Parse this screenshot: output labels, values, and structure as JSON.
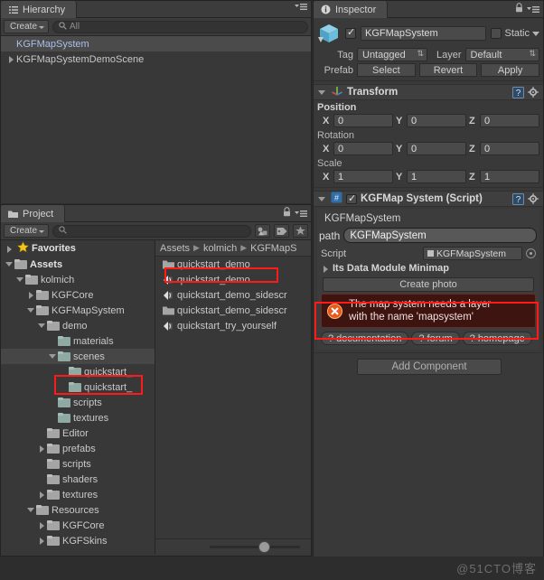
{
  "hierarchy": {
    "tab_label": "Hierarchy",
    "tab_icon": "hierarchy-icon",
    "create_label": "Create",
    "search_placeholder": "All",
    "search_value": "All",
    "items": [
      {
        "label": "KGFMapSystem",
        "selected": true,
        "expandable": false
      },
      {
        "label": "KGFMapSystemDemoScene",
        "selected": false,
        "expandable": true
      }
    ]
  },
  "project": {
    "tab_label": "Project",
    "create_label": "Create",
    "search_value": "",
    "filter_icons": [
      "type-filter-icon",
      "label-filter-icon",
      "favorite-filter-icon"
    ],
    "favorites_label": "Favorites",
    "breadcrumb": [
      "Assets",
      "kolmich",
      "KGFMapS"
    ],
    "tree": [
      {
        "label": "Assets",
        "indent": 0,
        "state": "open",
        "bold": true,
        "selected": false
      },
      {
        "label": "kolmich",
        "indent": 1,
        "state": "open",
        "bold": false,
        "selected": false
      },
      {
        "label": "KGFCore",
        "indent": 2,
        "state": "closed",
        "bold": false,
        "selected": false
      },
      {
        "label": "KGFMapSystem",
        "indent": 2,
        "state": "open",
        "bold": false,
        "selected": false
      },
      {
        "label": "demo",
        "indent": 3,
        "state": "open",
        "bold": false,
        "selected": false
      },
      {
        "label": "materials",
        "indent": 4,
        "state": "leaf",
        "bold": false,
        "selected": false
      },
      {
        "label": "scenes",
        "indent": 4,
        "state": "open",
        "bold": false,
        "selected": true
      },
      {
        "label": "quickstart_",
        "indent": 5,
        "state": "leaf",
        "bold": false,
        "selected": false
      },
      {
        "label": "quickstart_",
        "indent": 5,
        "state": "leaf",
        "bold": false,
        "selected": false
      },
      {
        "label": "scripts",
        "indent": 4,
        "state": "leaf",
        "bold": false,
        "selected": false
      },
      {
        "label": "textures",
        "indent": 4,
        "state": "leaf",
        "bold": false,
        "selected": false
      },
      {
        "label": "Editor",
        "indent": 3,
        "state": "leaf",
        "bold": false,
        "selected": false
      },
      {
        "label": "prefabs",
        "indent": 3,
        "state": "closed",
        "bold": false,
        "selected": false
      },
      {
        "label": "scripts",
        "indent": 3,
        "state": "leaf",
        "bold": false,
        "selected": false
      },
      {
        "label": "shaders",
        "indent": 3,
        "state": "leaf",
        "bold": false,
        "selected": false
      },
      {
        "label": "textures",
        "indent": 3,
        "state": "closed",
        "bold": false,
        "selected": false
      },
      {
        "label": "Resources",
        "indent": 2,
        "state": "open",
        "bold": false,
        "selected": false
      },
      {
        "label": "KGFCore",
        "indent": 3,
        "state": "closed",
        "bold": false,
        "selected": false
      },
      {
        "label": "KGFSkins",
        "indent": 3,
        "state": "closed",
        "bold": false,
        "selected": false
      }
    ],
    "assets": [
      {
        "label": "quickstart_demo",
        "icon": "folder-icon",
        "selected": false
      },
      {
        "label": "quickstart_demo",
        "icon": "unity-scene-icon",
        "selected": true
      },
      {
        "label": "quickstart_demo_sidescr",
        "icon": "unity-scene-icon",
        "selected": false
      },
      {
        "label": "quickstart_demo_sidescr",
        "icon": "folder-icon",
        "selected": false
      },
      {
        "label": "quickstart_try_yourself",
        "icon": "unity-scene-icon",
        "selected": false
      }
    ],
    "zoom_slider_value": 62
  },
  "inspector": {
    "tab_label": "Inspector",
    "tab_icon": "info-icon",
    "lock_icon": "lock-icon",
    "menu_icon": "hamburger-icon",
    "object_enabled": true,
    "object_name": "KGFMapSystem",
    "static_label": "Static",
    "static_checked": false,
    "tag_label": "Tag",
    "tag_value": "Untagged",
    "layer_label": "Layer",
    "layer_value": "Default",
    "prefab_label": "Prefab",
    "prefab_buttons": [
      "Select",
      "Revert",
      "Apply"
    ],
    "transform": {
      "title": "Transform",
      "icon": "transform-axis-icon",
      "help_icon": "help-book-icon",
      "gear_icon": "gear-icon",
      "position_label": "Position",
      "rotation_label": "Rotation",
      "scale_label": "Scale",
      "position": {
        "x": "0",
        "y": "0",
        "z": "0"
      },
      "rotation": {
        "x": "0",
        "y": "0",
        "z": "0"
      },
      "scale": {
        "x": "1",
        "y": "1",
        "z": "1"
      },
      "axis_labels": [
        "X",
        "Y",
        "Z"
      ]
    },
    "script_component": {
      "title": "KGFMap System (Script)",
      "icon": "cs-script-icon",
      "enabled": true,
      "help_icon": "help-book-icon",
      "gear_icon": "gear-icon",
      "inner_title": "KGFMapSystem",
      "path_label": "path",
      "path_value": "KGFMapSystem",
      "script_label": "Script",
      "script_value": "KGFMapSystem",
      "script_picker_icon": "object-picker-icon",
      "data_module_label": "Its Data Module Minimap",
      "create_photo_label": "Create photo",
      "error": {
        "icon": "error-x-icon",
        "line1": "The map system needs a layer",
        "line2": "with the name 'mapsystem'"
      },
      "links": [
        "? documentation",
        "? forum",
        "? homepage"
      ]
    },
    "add_component_label": "Add Component"
  },
  "watermark": "@51CTO博客",
  "colors": {
    "accent_red": "#ff1a1a",
    "error_bg": "#3d1410",
    "panel_bg": "#383838",
    "selection_blue": "#a9c0e8"
  }
}
